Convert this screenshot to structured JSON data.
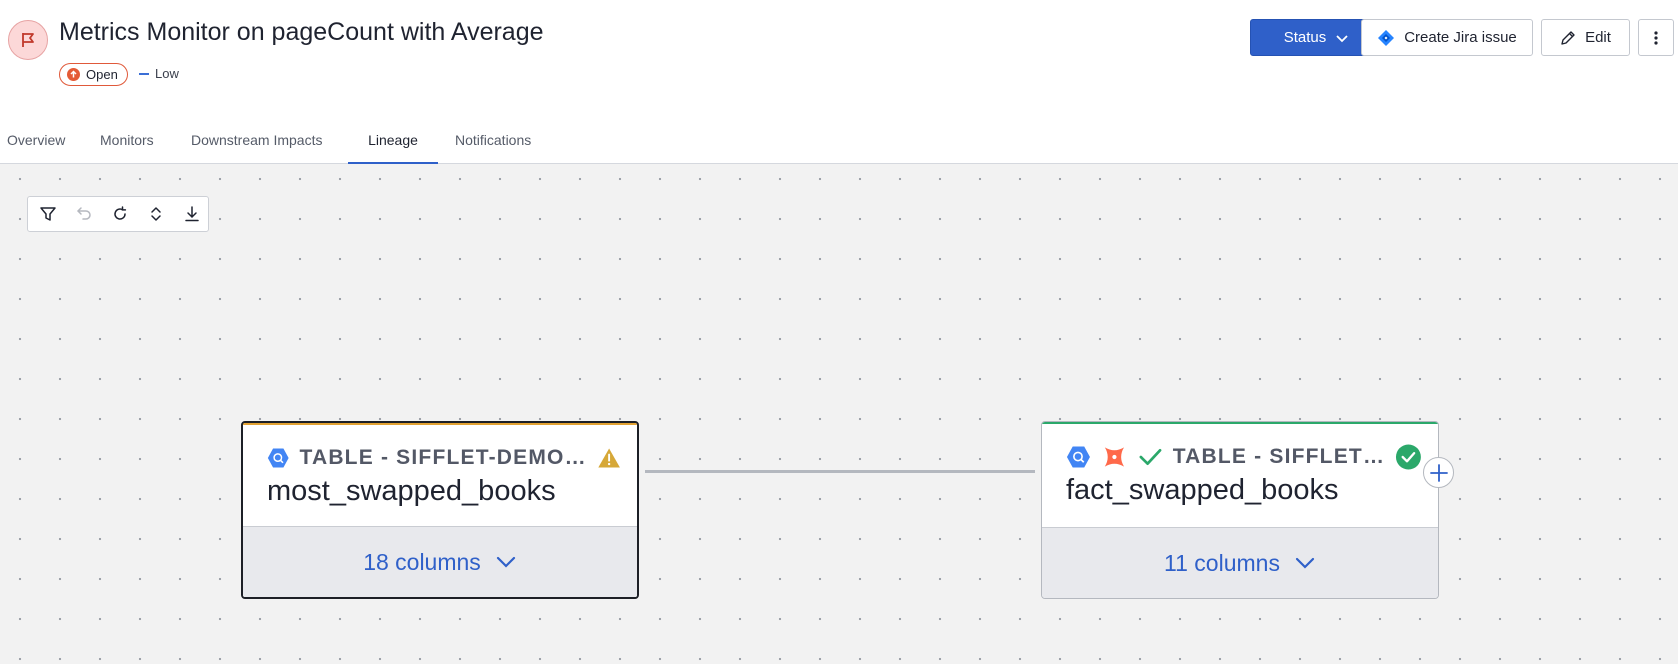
{
  "header": {
    "title": "Metrics Monitor on pageCount with Average",
    "status": "Open",
    "severity": "Low",
    "buttons": {
      "status": "Status",
      "jira": "Create Jira issue",
      "edit": "Edit"
    }
  },
  "tabs": [
    {
      "label": "Overview",
      "active": false
    },
    {
      "label": "Monitors",
      "active": false
    },
    {
      "label": "Downstream Impacts",
      "active": false
    },
    {
      "label": "Lineage",
      "active": true
    },
    {
      "label": "Notifications",
      "active": false
    }
  ],
  "toolbar": {
    "tools": [
      "filter-icon",
      "undo-icon",
      "reset-icon",
      "expand-collapse-icon",
      "download-icon"
    ]
  },
  "lineage": {
    "nodes": [
      {
        "type": "TABLE - SIFFLET-DEMO…",
        "name": "most_swapped_books",
        "columns": "18 columns",
        "status": "warning"
      },
      {
        "type": "TABLE - SIFFLET…",
        "name": "fact_swapped_books",
        "columns": "11 columns",
        "status": "ok"
      }
    ]
  },
  "colors": {
    "accent": "#2f60c9",
    "open_status": "#e45b36",
    "warning": "#e2a233",
    "success": "#2ba86a"
  }
}
